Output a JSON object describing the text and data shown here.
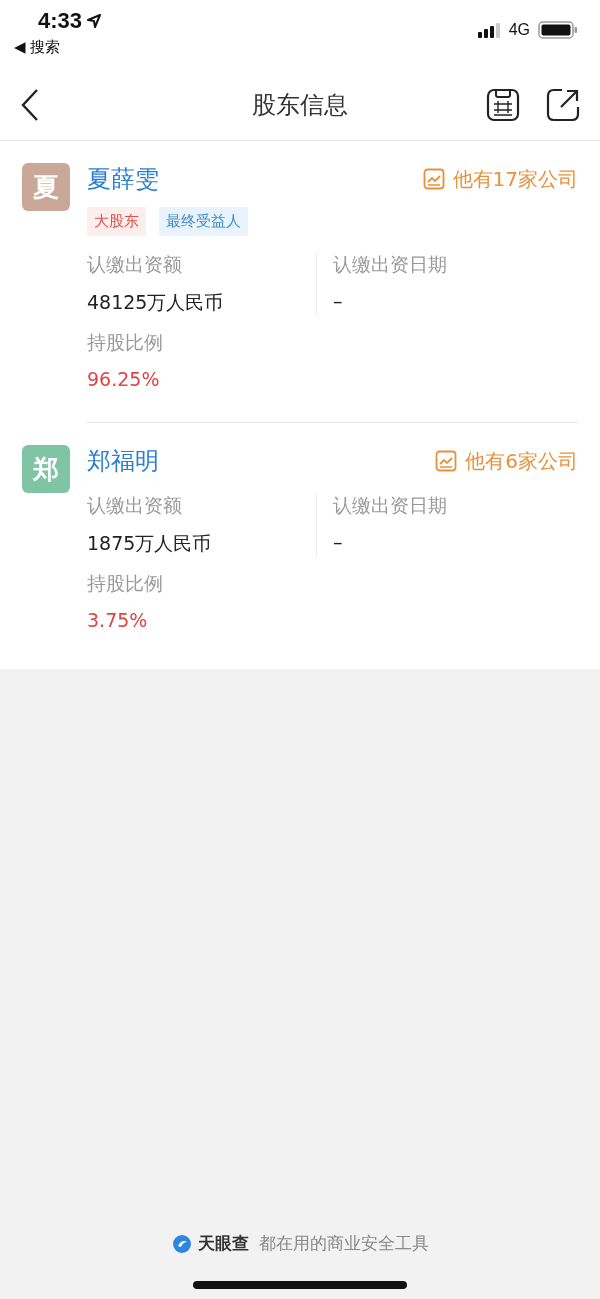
{
  "status_bar": {
    "time": "4:33",
    "back_app": "◀ 搜索",
    "network": "4G"
  },
  "nav": {
    "title": "股东信息"
  },
  "shareholders": [
    {
      "avatar": "夏",
      "color": "#c9a898",
      "name": "夏薛雯",
      "companies": "他有17家公司",
      "tags": [
        {
          "label": "大股东",
          "kind": "major"
        },
        {
          "label": "最终受益人",
          "kind": "beneficiary"
        }
      ],
      "amount_label": "认缴出资额",
      "amount": "48125万人民币",
      "date_label": "认缴出资日期",
      "date": "–",
      "ratio_label": "持股比例",
      "ratio": "96.25%"
    },
    {
      "avatar": "郑",
      "color": "#7fc4a4",
      "name": "郑福明",
      "companies": "他有6家公司",
      "amount_label": "认缴出资额",
      "amount": "1875万人民币",
      "date_label": "认缴出资日期",
      "date": "–",
      "ratio_label": "持股比例",
      "ratio": "3.75%"
    }
  ],
  "footer": {
    "brand": "天眼查",
    "slogan": "都在用的商业安全工具"
  }
}
